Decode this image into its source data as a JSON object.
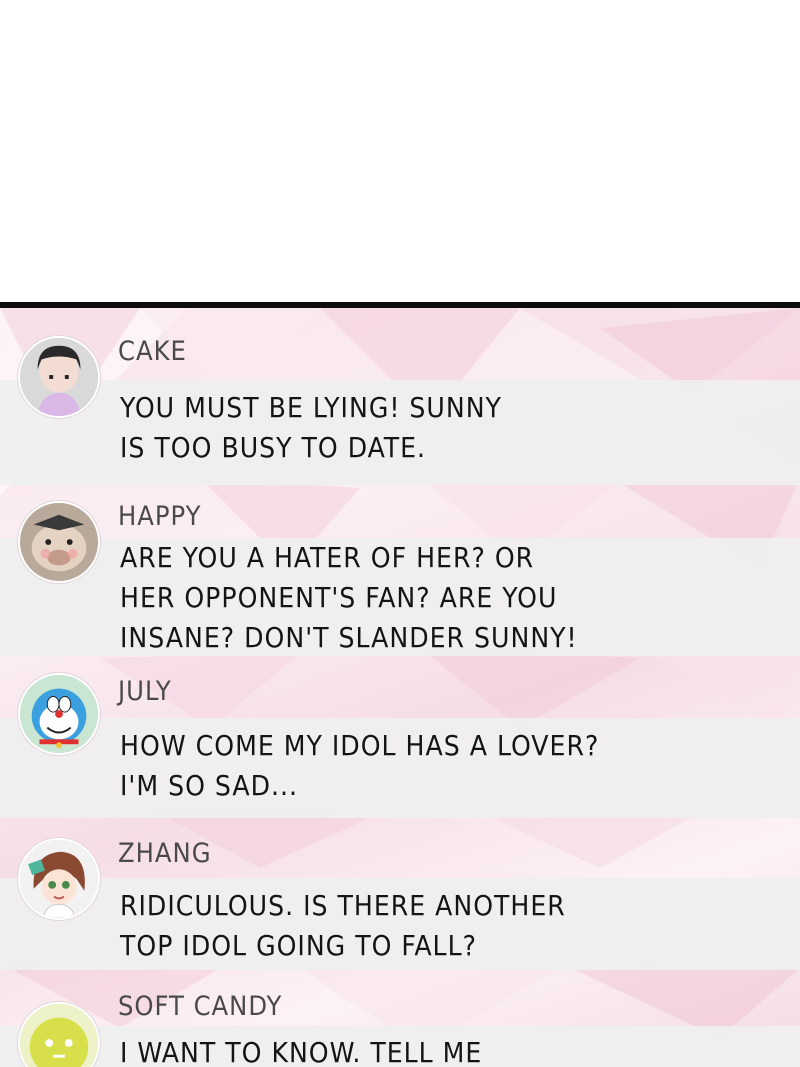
{
  "comments": [
    {
      "name": "CAKE",
      "lines": [
        "YOU MUST BE LYING! SUNNY",
        "IS TOO BUSY TO DATE."
      ]
    },
    {
      "name": "HAPPY",
      "lines": [
        "ARE YOU A HATER OF HER? OR",
        "HER OPPONENT'S FAN? ARE YOU",
        "INSANE? DON'T SLANDER SUNNY!"
      ]
    },
    {
      "name": "JULY",
      "lines": [
        "HOW COME MY IDOL HAS A LOVER?",
        "I'M SO SAD..."
      ]
    },
    {
      "name": "ZHANG",
      "lines": [
        "RIDICULOUS. IS THERE ANOTHER",
        "TOP IDOL GOING TO FALL?"
      ]
    },
    {
      "name": "SOFT CANDY",
      "lines": [
        "I WANT TO KNOW. TELL ME"
      ]
    }
  ]
}
